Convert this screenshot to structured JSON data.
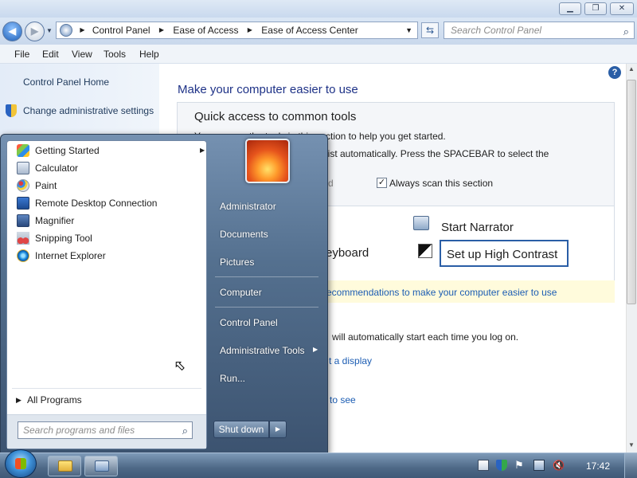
{
  "window": {
    "caption_buttons": [
      "minimize",
      "maximize",
      "close"
    ]
  },
  "address_bar": {
    "back_icon": "back-arrow-icon",
    "forward_icon": "forward-arrow-icon",
    "breadcrumbs": [
      "Control Panel",
      "Ease of Access",
      "Ease of Access Center"
    ],
    "search_placeholder": "Search Control Panel"
  },
  "menu": {
    "items": [
      "File",
      "Edit",
      "View",
      "Tools",
      "Help"
    ]
  },
  "left_pane": {
    "home": "Control Panel Home",
    "admin": "Change administrative settings"
  },
  "main": {
    "heading": "Make your computer easier to use",
    "group_title": "Quick access to common tools",
    "line1": "You can use the tools in this section to help you get started.",
    "line2": "list automatically.  Press the SPACEBAR to select the",
    "line3_left": "d",
    "always_scan": "Always scan this section",
    "narrator": "Start Narrator",
    "keyboard": "eyboard",
    "high_contrast": "Set up High Contrast",
    "recommend": "ecommendations to make your computer easier to use",
    "autostart": "will automatically start each time you log on.",
    "display": "t a display",
    "to_see": "to see"
  },
  "start_menu": {
    "programs": [
      {
        "label": "Getting Started",
        "icon": "getting-started-icon",
        "has_arrow": true
      },
      {
        "label": "Calculator",
        "icon": "calculator-icon"
      },
      {
        "label": "Paint",
        "icon": "paint-icon"
      },
      {
        "label": "Remote Desktop Connection",
        "icon": "remote-desktop-icon"
      },
      {
        "label": "Magnifier",
        "icon": "magnifier-icon"
      },
      {
        "label": "Snipping Tool",
        "icon": "snipping-tool-icon"
      },
      {
        "label": "Internet Explorer",
        "icon": "internet-explorer-icon"
      }
    ],
    "all_programs": "All Programs",
    "search_placeholder": "Search programs and files",
    "right_links": [
      "Administrator",
      "Documents",
      "Pictures",
      "Computer",
      "Control Panel",
      "Administrative Tools",
      "Run..."
    ],
    "shutdown": "Shut down"
  },
  "taskbar": {
    "clock": "17:42"
  },
  "colors": {
    "link": "#1c5db3",
    "heading": "#1e3287",
    "accent": "#2a5ea6"
  }
}
